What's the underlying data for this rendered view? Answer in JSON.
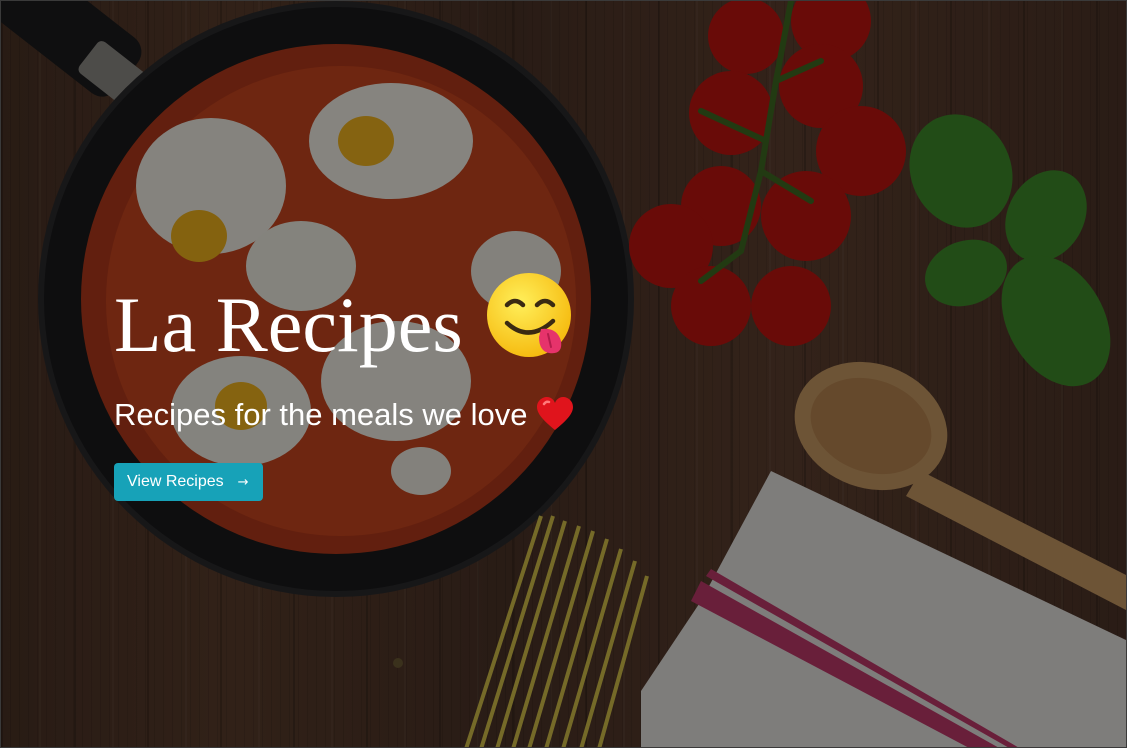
{
  "hero": {
    "title": "La Recipes",
    "title_icon": "savoring-food-face-emoji",
    "subtitle": "Recipes for the meals we love",
    "subtitle_icon": "red-heart-emoji",
    "cta_label": "View Recipes",
    "cta_icon": "right-arrow-icon",
    "cta_arrow": "→",
    "cta_color": "#17a2b8",
    "background_image": "food-photo-pan-tomatoes-basil-spoon-pasta-towel"
  }
}
